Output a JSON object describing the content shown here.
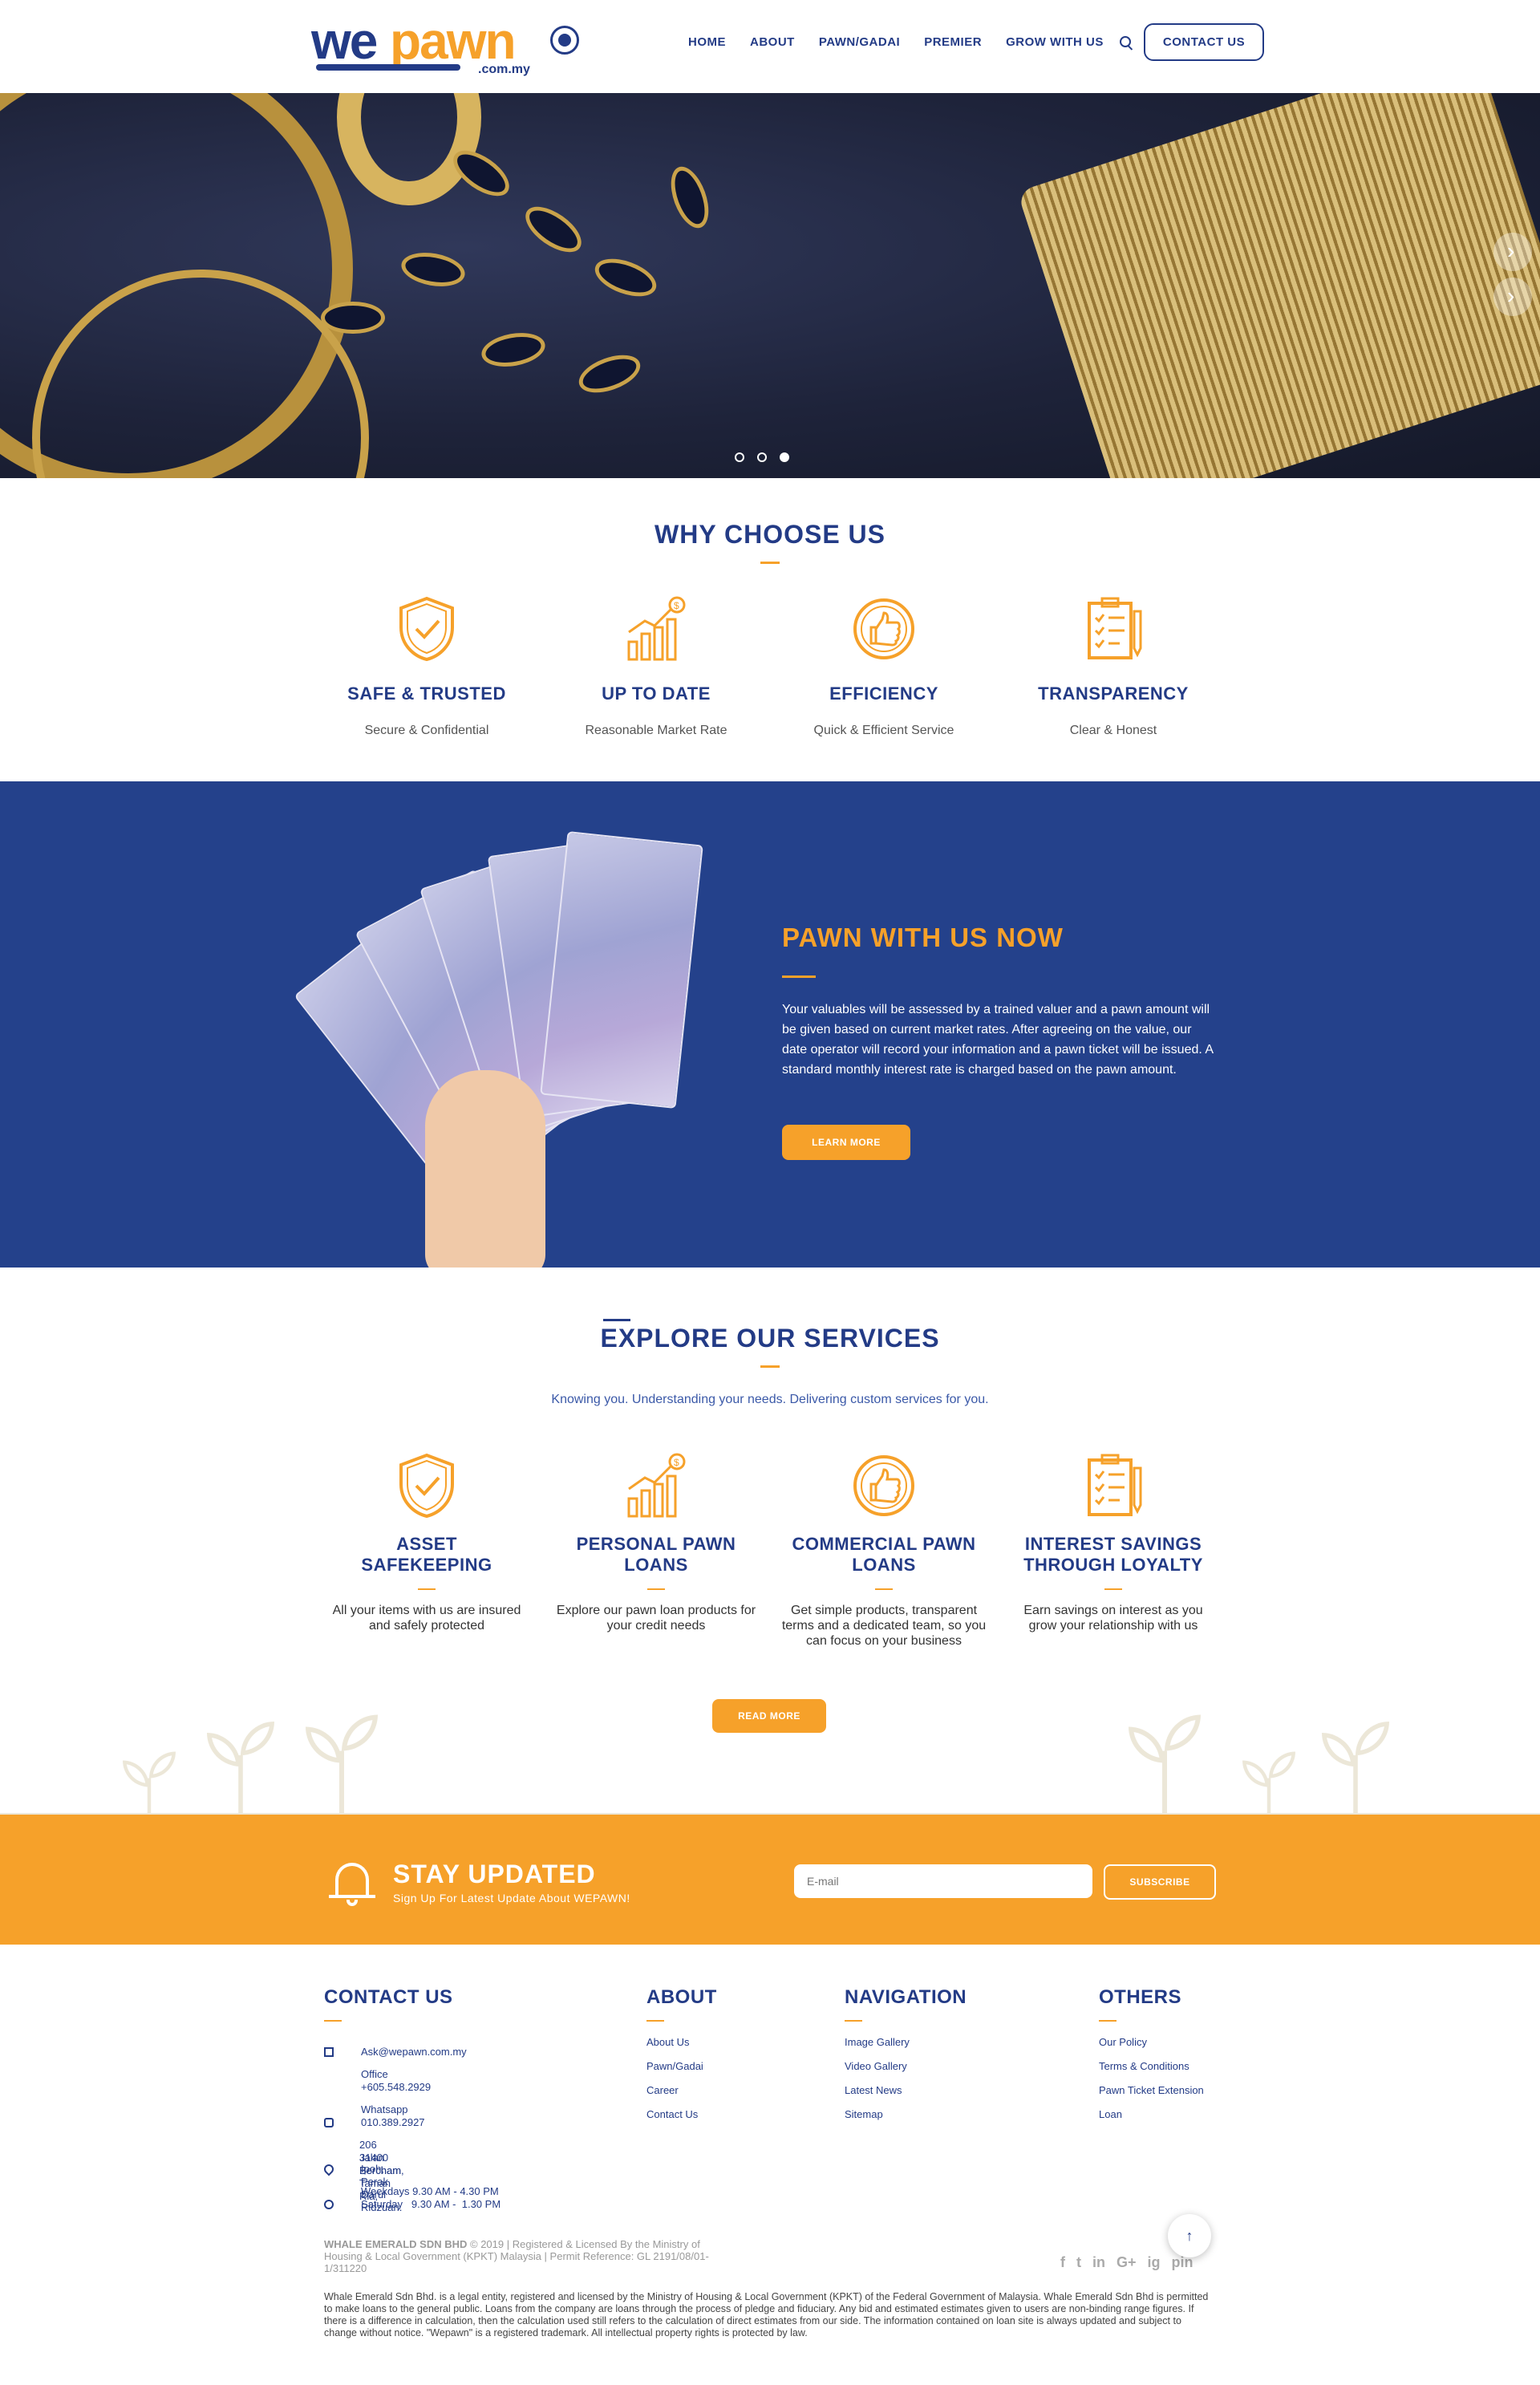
{
  "header": {
    "logo": {
      "we": "we",
      "pawn": "pawn",
      "domain": ".com.my"
    },
    "nav": [
      "HOME",
      "ABOUT",
      "PAWN/GADAI",
      "PREMIER",
      "GROW WITH US"
    ],
    "contact_button": "CONTACT US"
  },
  "hero": {
    "slides": 3,
    "active_slide": 3
  },
  "why": {
    "title": "WHY CHOOSE US",
    "features": [
      {
        "icon": "shield-check-icon",
        "title": "SAFE & TRUSTED",
        "desc": "Secure & Confidential"
      },
      {
        "icon": "growth-chart-icon",
        "title": "UP TO DATE",
        "desc": "Reasonable Market Rate"
      },
      {
        "icon": "thumbs-up-icon",
        "title": "EFFICIENCY",
        "desc": "Quick & Efficient Service"
      },
      {
        "icon": "clipboard-icon",
        "title": "TRANSPARENCY",
        "desc": "Clear & Honest"
      }
    ]
  },
  "pawn": {
    "title": "PAWN WITH US NOW",
    "body": "Your valuables will be assessed by a trained valuer and a pawn amount will be given based on current market rates. After agreeing on the value, our date operator will record your information and a pawn ticket will be issued. A standard monthly interest rate is charged based on the pawn amount.",
    "button": "LEARN MORE"
  },
  "services": {
    "title": "EXPLORE OUR SERVICES",
    "subtitle": "Knowing you. Understanding your needs. Delivering custom services for you.",
    "items": [
      {
        "icon": "shield-check-icon",
        "title_1": "ASSET",
        "title_2": "SAFEKEEPING",
        "desc": "All your items with us are insured and safely protected"
      },
      {
        "icon": "growth-chart-icon",
        "title_1": "PERSONAL PAWN",
        "title_2": "LOANS",
        "desc": "Explore our pawn loan products for your credit needs"
      },
      {
        "icon": "thumbs-up-icon",
        "title_1": "COMMERCIAL PAWN",
        "title_2": "LOANS",
        "desc": "Get simple products, transparent terms and a dedicated team, so you can focus on your business"
      },
      {
        "icon": "clipboard-icon",
        "title_1": "INTEREST SAVINGS",
        "title_2": "THROUGH LOYALTY",
        "desc": "Earn savings on interest as you grow your relationship with us"
      }
    ],
    "button": "READ MORE"
  },
  "newsletter": {
    "title": "STAY UPDATED",
    "tagline": "Sign Up For Latest Update About WEPAWN!",
    "email_placeholder": "E-mail",
    "button": "SUBSCRIBE"
  },
  "footer": {
    "contact": {
      "title": "CONTACT US",
      "email": "Ask@wepawn.com.my",
      "office_label": "Office",
      "office_phone": "+605.548.2929",
      "whatsapp_label": "Whatsapp",
      "whatsapp_phone": "010.389.2927",
      "address_1": "206 Jalan Bercham, Taman Ria,",
      "address_2": "31400 Bercham",
      "address_3": "Ipoh, Perak Darul Ridzuan.",
      "hours_1": "Weekdays 9.30 AM - 4.30 PM",
      "hours_2": "Saturday   9.30 AM -  1.30 PM"
    },
    "about": {
      "title": "ABOUT",
      "links": [
        "About Us",
        "Pawn/Gadai",
        "Career",
        "Contact Us"
      ]
    },
    "navigation": {
      "title": "NAVIGATION",
      "links": [
        "Image Gallery",
        "Video Gallery",
        "Latest News",
        "Sitemap"
      ]
    },
    "others": {
      "title": "OTHERS",
      "links": [
        "Our Policy",
        "Terms & Conditions",
        "Pawn Ticket Extension",
        "Loan"
      ]
    },
    "company": "WHALE EMERALD SDN BHD",
    "legal_rest": " © 2019 | Registered & Licensed By the Ministry of Housing & Local Government (KPKT) Malaysia | Permit Reference: GL 2191/08/01-1/311220",
    "disclaimer": "Whale Emerald Sdn Bhd. is a legal entity, registered and licensed by the Ministry of Housing & Local Government (KPKT) of the Federal Government of Malaysia. Whale Emerald Sdn Bhd is permitted to make loans to the general public. Loans from the company are loans through the process of pledge and fiduciary. Any bid and estimated estimates given to users are non-binding range figures. If there is a difference in calculation, then the calculation used still refers to the calculation of direct estimates from our side. The information contained on loan site is always updated and subject to change without notice. \"Wepawn\" is a registered trademark. All intellectual property rights is protected by law.",
    "social_icons": [
      "f",
      "t",
      "in",
      "G+",
      "ig",
      "pin"
    ],
    "to_top": "↑"
  },
  "colors": {
    "navy": "#233b86",
    "orange": "#f6a12a",
    "band": "#24418b"
  }
}
